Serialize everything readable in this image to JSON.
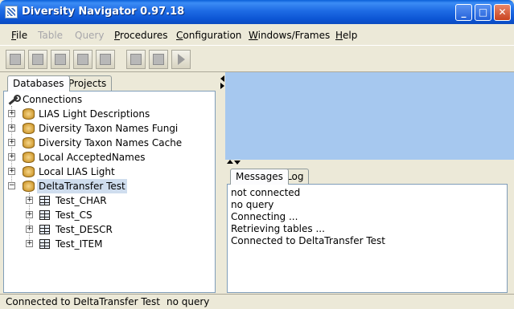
{
  "window": {
    "title": "Diversity Navigator 0.97.18",
    "buttons": {
      "minimize": "_",
      "maximize": "□",
      "close": "✕"
    }
  },
  "menu": {
    "items": [
      {
        "label": "File",
        "mnemonic": "F",
        "rest": "ile",
        "enabled": true
      },
      {
        "label": "Table",
        "mnemonic": "",
        "rest": "Table",
        "enabled": false
      },
      {
        "label": "Query",
        "mnemonic": "",
        "rest": "Query",
        "enabled": false
      },
      {
        "label": "Procedures",
        "mnemonic": "P",
        "rest": "rocedures",
        "enabled": true
      },
      {
        "label": "Configuration",
        "mnemonic": "C",
        "rest": "onfiguration",
        "enabled": true
      },
      {
        "label": "Windows/Frames",
        "mnemonic": "W",
        "rest": "indows/Frames",
        "enabled": true
      },
      {
        "label": "Help",
        "mnemonic": "H",
        "rest": "elp",
        "enabled": true
      }
    ]
  },
  "left_panel": {
    "tabs": [
      "Databases",
      "Projects"
    ],
    "active_tab": "Databases",
    "tree": {
      "root": "Connections",
      "connections": [
        "LIAS Light Descriptions",
        "Diversity Taxon Names Fungi",
        "Diversity Taxon Names Cache",
        "Local AcceptedNames",
        "Local LIAS Light",
        "DeltaTransfer Test"
      ],
      "selected": "DeltaTransfer Test",
      "tables": [
        "Test_CHAR",
        "Test_CS",
        "Test_DESCR",
        "Test_ITEM"
      ]
    }
  },
  "right_panel": {
    "tabs": [
      "Messages",
      "Log"
    ],
    "active_tab": "Messages",
    "messages": [
      "not connected",
      "no query",
      "Connecting ...",
      "Retrieving tables ...",
      "Connected to DeltaTransfer Test"
    ],
    "top_area_color": "#a6c8ef"
  },
  "status": {
    "connection": "Connected to DeltaTransfer Test",
    "query": "no query"
  }
}
